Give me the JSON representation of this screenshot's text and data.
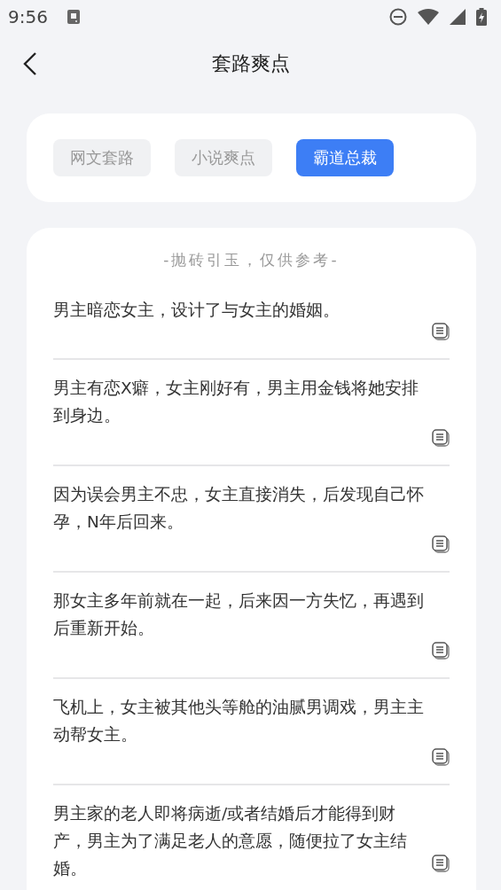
{
  "status_bar": {
    "time": "9:56"
  },
  "header": {
    "title": "套路爽点"
  },
  "tabs": [
    {
      "label": "网文套路",
      "selected": false
    },
    {
      "label": "小说爽点",
      "selected": false
    },
    {
      "label": "霸道总裁",
      "selected": true
    }
  ],
  "list": {
    "subtitle": "-抛砖引玉，仅供参考-",
    "items": [
      {
        "text": "男主暗恋女主，设计了与女主的婚姻。"
      },
      {
        "text": "男主有恋X癖，女主刚好有，男主用金钱将她安排到身边。"
      },
      {
        "text": "因为误会男主不忠，女主直接消失，后发现自己怀孕，N年后回来。"
      },
      {
        "text": "那女主多年前就在一起，后来因一方失忆，再遇到后重新开始。"
      },
      {
        "text": "飞机上，女主被其他头等舱的油腻男调戏，男主主动帮女主。"
      },
      {
        "text": "男主家的老人即将病逝/或者结婚后才能得到财产，男主为了满足老人的意愿，随便拉了女主结婚。"
      }
    ]
  }
}
